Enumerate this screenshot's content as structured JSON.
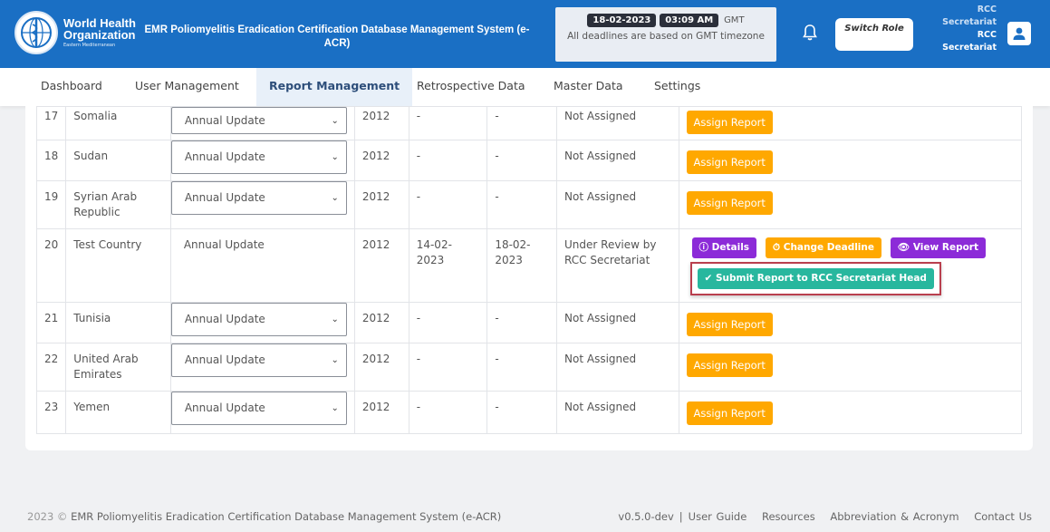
{
  "header": {
    "org_line1": "World Health",
    "org_line2": "Organization",
    "org_line3": "Eastern Mediterranean",
    "app_title": "EMR Poliomyelitis Eradication Certification Database Management System (e-ACR)",
    "date": "18-02-2023",
    "time": "03:09 AM",
    "tz": "GMT",
    "deadline_note": "All deadlines are based on GMT timezone",
    "switch_role": "Switch Role",
    "user_role_line1": "RCC Secretariat",
    "user_role_line2": "RCC Secretariat"
  },
  "nav": {
    "items": [
      "Dashboard",
      "User Management",
      "Report Management",
      "Retrospective Data",
      "Master Data",
      "Settings"
    ],
    "active": "Report Management"
  },
  "table": {
    "rows": [
      {
        "no": "17",
        "country": "Somalia",
        "report": "Annual Update",
        "year": "2012",
        "from": "-",
        "to": "-",
        "status": "Not Assigned",
        "action": "Assign Report"
      },
      {
        "no": "18",
        "country": "Sudan",
        "report": "Annual Update",
        "year": "2012",
        "from": "-",
        "to": "-",
        "status": "Not Assigned",
        "action": "Assign Report"
      },
      {
        "no": "19",
        "country": "Syrian Arab Republic",
        "report": "Annual Update",
        "year": "2012",
        "from": "-",
        "to": "-",
        "status": "Not Assigned",
        "action": "Assign Report"
      },
      {
        "no": "20",
        "country": "Test Country",
        "report": "Annual Update",
        "year": "2012",
        "from": "14-02-2023",
        "to": "18-02-2023",
        "status": "Under Review by RCC Secretariat",
        "details": "Details",
        "change_deadline": "Change Deadline",
        "view_report": "View Report",
        "submit": "Submit Report to RCC Secretariat Head"
      },
      {
        "no": "21",
        "country": "Tunisia",
        "report": "Annual Update",
        "year": "2012",
        "from": "-",
        "to": "-",
        "status": "Not Assigned",
        "action": "Assign Report"
      },
      {
        "no": "22",
        "country": "United Arab Emirates",
        "report": "Annual Update",
        "year": "2012",
        "from": "-",
        "to": "-",
        "status": "Not Assigned",
        "action": "Assign Report"
      },
      {
        "no": "23",
        "country": "Yemen",
        "report": "Annual Update",
        "year": "2012",
        "from": "-",
        "to": "-",
        "status": "Not Assigned",
        "action": "Assign Report"
      }
    ]
  },
  "footer": {
    "copyright": "2023 ©",
    "system": "EMR Poliomyelitis Eradication Certification Database Management System (e-ACR)",
    "version": "v0.5.0-dev",
    "links": [
      "User Guide",
      "Resources",
      "Abbreviation & Acronym",
      "Contact Us"
    ]
  },
  "colors": {
    "brand": "#1a6fc4",
    "assign": "#ffa800",
    "purple": "#8c2bd8",
    "teal": "#28b79e",
    "highlight": "#b93f4e"
  }
}
